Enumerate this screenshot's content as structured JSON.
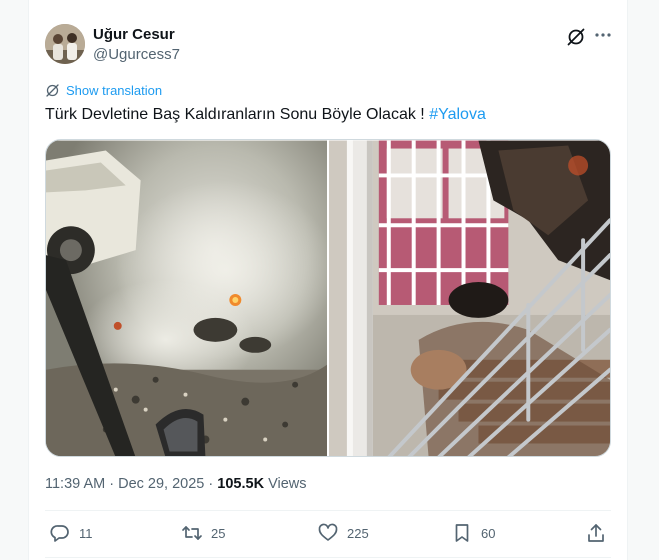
{
  "author": {
    "display_name": "Uğur Cesur",
    "handle": "@Ugurcess7",
    "avatar_icon": "user-avatar"
  },
  "header_actions": {
    "grok_icon": "grok-icon",
    "more_icon": "more-options-icon"
  },
  "translation": {
    "label": "Show translation",
    "icon": "translate-icon"
  },
  "tweet": {
    "text": "Türk Devletine Baş Kaldıranların Sonu Böyle Olacak !",
    "hashtag": "#Yalova"
  },
  "media": {
    "count": 2,
    "items": [
      "smoke-debris-photo",
      "burnt-staircase-photo"
    ]
  },
  "meta": {
    "time": "11:39 AM",
    "separator": "·",
    "date": "Dec 29, 2025",
    "views_count": "105.5K",
    "views_label": "Views"
  },
  "actions": {
    "replies": "11",
    "reposts": "25",
    "likes": "225",
    "bookmarks": "60"
  },
  "colors": {
    "accent": "#1d9bf0",
    "secondary_text": "#536471",
    "primary_text": "#0f1419",
    "border": "#cfd9de"
  }
}
